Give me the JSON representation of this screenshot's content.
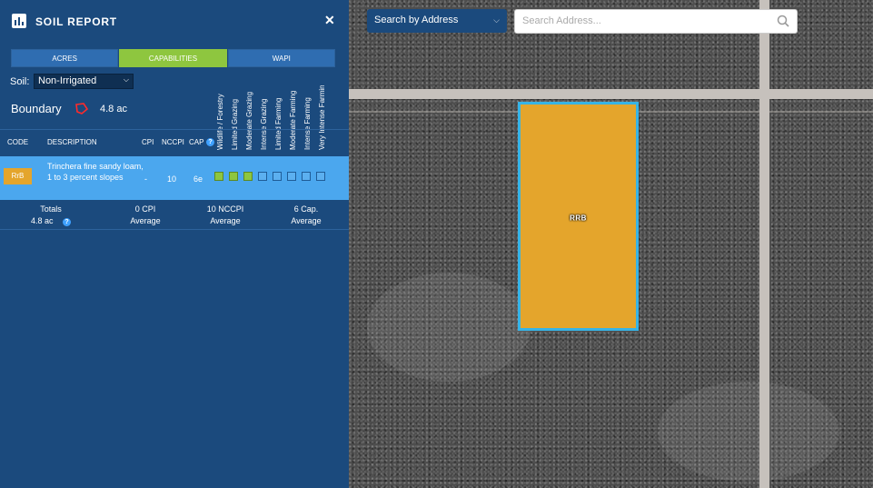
{
  "panel": {
    "title": "SOIL REPORT",
    "close_icon": "close-icon",
    "tabs": [
      {
        "label": "ACRES",
        "active": false
      },
      {
        "label": "CAPABILITIES",
        "active": true
      },
      {
        "label": "WAPI",
        "active": false
      }
    ],
    "soil_label": "Soil:",
    "soil_value": "Non-Irrigated",
    "boundary_label": "Boundary",
    "boundary_acres": "4.8 ac",
    "capability_headers": [
      "Wildlife / Forestry",
      "Limited Grazing",
      "Moderate Grazing",
      "Intense Grazing",
      "Limited Farming",
      "Moderate Farming",
      "Intense Farming",
      "Very Intense Farmin"
    ],
    "table_headers": {
      "code": "CODE",
      "description": "DESCRIPTION",
      "cpi": "CPI",
      "nccpi": "NCCPI",
      "cap": "CAP"
    },
    "rows": [
      {
        "code": "RrB",
        "description": "Trinchera fine sandy loam, 1 to 3 percent slopes",
        "cpi": "-",
        "nccpi": "10",
        "cap": "6e",
        "capability_count": 3,
        "badge_color": "#e4a52c"
      }
    ],
    "totals": {
      "label": "Totals",
      "acres": "4.8 ac",
      "cpi_value": "0 CPI",
      "cpi_sub": "Average",
      "nccpi_value": "10 NCCPI",
      "nccpi_sub": "Average",
      "cap_value": "6 Cap.",
      "cap_sub": "Average"
    }
  },
  "map": {
    "search_mode": "Search by Address",
    "search_placeholder": "Search Address...",
    "parcel_label": "RRB",
    "parcel_color": "#e4a52c",
    "parcel_border": "#37b4e6"
  },
  "colors": {
    "panel_bg": "#1b4a7d",
    "accent_green": "#8ec63f",
    "row_highlight": "#4ba7ee"
  }
}
